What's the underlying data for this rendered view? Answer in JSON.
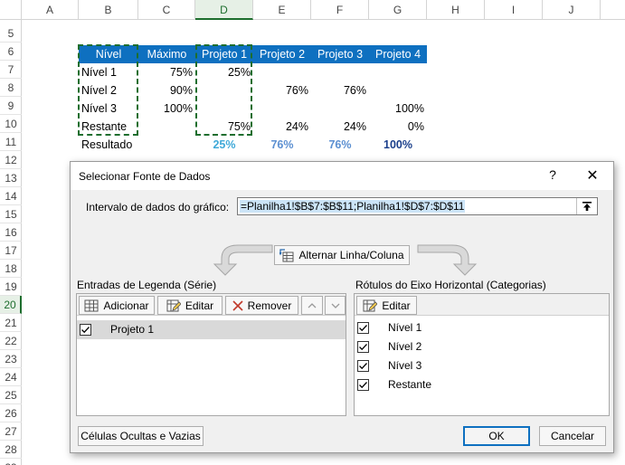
{
  "sheet": {
    "columns": [
      "A",
      "B",
      "C",
      "D",
      "E",
      "F",
      "G",
      "H",
      "I",
      "J"
    ],
    "rows": [
      "5",
      "6",
      "7",
      "8",
      "9",
      "10",
      "11",
      "12",
      "13",
      "14",
      "15",
      "16",
      "17",
      "18",
      "19",
      "20",
      "21",
      "22",
      "23",
      "24",
      "25",
      "26",
      "27",
      "28",
      "29"
    ],
    "selected_column": "D",
    "selected_row": "20",
    "table": {
      "headers": [
        "Nível",
        "Máximo",
        "Projeto 1",
        "Projeto 2",
        "Projeto 3",
        "Projeto 4"
      ],
      "rows": [
        {
          "label": "Nível 1",
          "maximo": "75%",
          "p1": "25%",
          "p2": "",
          "p3": "",
          "p4": ""
        },
        {
          "label": "Nível 2",
          "maximo": "90%",
          "p1": "",
          "p2": "76%",
          "p3": "76%",
          "p4": ""
        },
        {
          "label": "Nível 3",
          "maximo": "100%",
          "p1": "",
          "p2": "",
          "p3": "",
          "p4": "100%"
        },
        {
          "label": "Restante",
          "maximo": "",
          "p1": "75%",
          "p2": "24%",
          "p3": "24%",
          "p4": "0%"
        }
      ],
      "result": {
        "label": "Resultado",
        "p1": "25%",
        "p2": "76%",
        "p3": "76%",
        "p4": "100%"
      }
    },
    "colors": {
      "header_bg": "#0e70c0",
      "result_p1": "#3fa9d8",
      "result_p2": "#5b8fd1",
      "result_p3": "#5b8fd1",
      "result_p4": "#1b3f8b",
      "selection": "#1e6e2e"
    }
  },
  "dialog": {
    "title": "Selecionar Fonte de Dados",
    "help_label": "?",
    "close_label": "✕",
    "range_label": "Intervalo de dados do gráfico:",
    "range_value": "=Planilha1!$B$7:$B$11;Planilha1!$D$7:$D$11",
    "switch_label": "Alternar Linha/Coluna",
    "legend": {
      "title": "Entradas de Legenda (Série)",
      "add_label": "Adicionar",
      "edit_label": "Editar",
      "remove_label": "Remover",
      "items": [
        {
          "label": "Projeto 1",
          "checked": true
        }
      ]
    },
    "axis": {
      "title": "Rótulos do Eixo Horizontal (Categorias)",
      "edit_label": "Editar",
      "items": [
        {
          "label": "Nível 1",
          "checked": true
        },
        {
          "label": "Nível 2",
          "checked": true
        },
        {
          "label": "Nível 3",
          "checked": true
        },
        {
          "label": "Restante",
          "checked": true
        }
      ]
    },
    "hidden_cells_label": "Células Ocultas e Vazias",
    "ok_label": "OK",
    "cancel_label": "Cancelar"
  }
}
